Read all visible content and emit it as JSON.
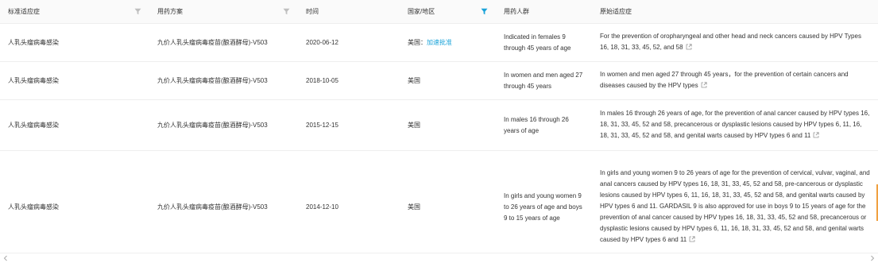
{
  "columns": [
    {
      "label": "标准适应症",
      "filter": true,
      "filter_active": false
    },
    {
      "label": "用药方案",
      "filter": true,
      "filter_active": false
    },
    {
      "label": "时间",
      "filter": false,
      "filter_active": false
    },
    {
      "label": "国家/地区",
      "filter": true,
      "filter_active": true
    },
    {
      "label": "用药人群",
      "filter": false,
      "filter_active": false
    },
    {
      "label": "原始适应症",
      "filter": false,
      "filter_active": false
    }
  ],
  "colors": {
    "filter_active": "#1aa3d9",
    "filter_inactive": "#bfbfbf",
    "link": "#1aa3d9"
  },
  "rows": [
    {
      "indication": "人乳头瘤病毒感染",
      "regimen": "九价人乳头瘤病毒疫苗(酿酒酵母)-V503",
      "date": "2020-06-12",
      "country": "美国：",
      "country_link": "加速批准",
      "population": "Indicated in females 9 through 45 years of age",
      "original": "For the prevention of oropharyngeal and other head and neck cancers caused by HPV Types 16, 18, 31, 33, 45, 52, and 58"
    },
    {
      "indication": "人乳头瘤病毒感染",
      "regimen": "九价人乳头瘤病毒疫苗(酿酒酵母)-V503",
      "date": "2018-10-05",
      "country": "美国",
      "country_link": "",
      "population": "In women and men aged 27 through 45 years",
      "original": "In women and men aged 27 through 45 years，for the prevention of certain cancers and diseases caused by the HPV types"
    },
    {
      "indication": "人乳头瘤病毒感染",
      "regimen": "九价人乳头瘤病毒疫苗(酿酒酵母)-V503",
      "date": "2015-12-15",
      "country": "美国",
      "country_link": "",
      "population": "In males 16 through 26 years of age",
      "original": "In males 16 through 26 years of age, for the prevention of anal cancer caused by HPV types 16, 18, 31, 33, 45, 52 and 58, precancerous or dysplastic lesions caused by HPV types 6, 11, 16, 18, 31, 33, 45, 52 and 58, and genital warts caused by HPV types 6 and 11"
    },
    {
      "indication": "人乳头瘤病毒感染",
      "regimen": "九价人乳头瘤病毒疫苗(酿酒酵母)-V503",
      "date": "2014-12-10",
      "country": "美国",
      "country_link": "",
      "population": "In girls and young women 9 to 26 years of age and boys 9 to 15 years of age",
      "original": "In girls and young women 9 to 26 years of age for the prevention of cervical, vulvar, vaginal, and anal cancers caused by HPV types 16, 18, 31, 33, 45, 52 and 58, pre-cancerous or dysplastic lesions caused by HPV types 6, 11, 16, 18, 31, 33, 45, 52 and 58, and genital warts caused by HPV types 6 and 11. GARDASIL 9 is also approved for use in boys 9 to 15 years of age for the prevention of anal cancer caused by HPV types 16, 18, 31, 33, 45, 52 and 58, precancerous or dysplastic lesions caused by HPV types 6, 11, 16, 18, 31, 33, 45, 52 and 58, and genital warts caused by HPV types 6 and 11"
    }
  ]
}
